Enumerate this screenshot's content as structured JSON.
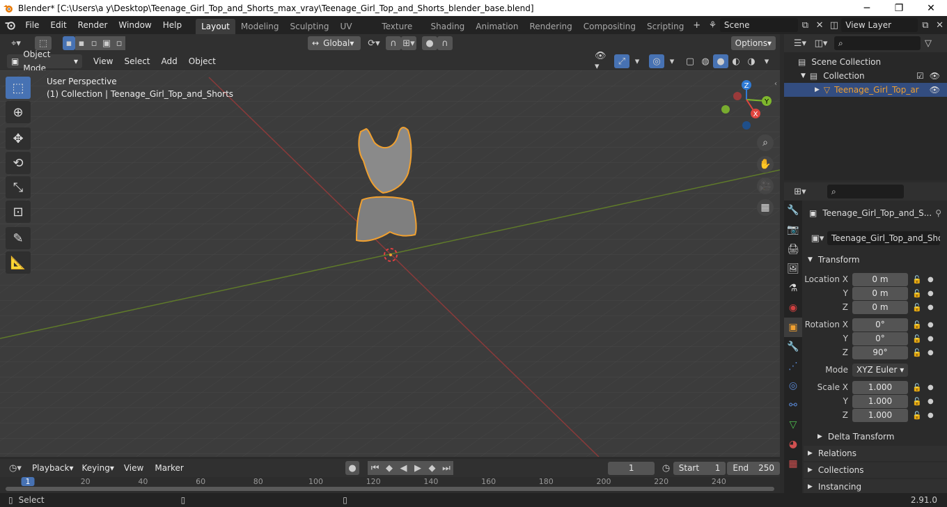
{
  "window": {
    "title": "Blender* [C:\\Users\\a y\\Desktop\\Teenage_Girl_Top_and_Shorts_max_vray\\Teenage_Girl_Top_and_Shorts_blender_base.blend]"
  },
  "menus": [
    "File",
    "Edit",
    "Render",
    "Window",
    "Help"
  ],
  "workspaces": [
    "Layout",
    "Modeling",
    "Sculpting",
    "UV Editing",
    "Texture Paint",
    "Shading",
    "Animation",
    "Rendering",
    "Compositing",
    "Scripting"
  ],
  "scene": {
    "name": "Scene",
    "view_layer": "View Layer"
  },
  "viewport": {
    "transform_orientation": "Global",
    "options_label": "Options",
    "mode": "Object Mode",
    "header_menus": [
      "View",
      "Select",
      "Add",
      "Object"
    ],
    "perspective_label": "User Perspective",
    "collection_label": "(1) Collection | Teenage_Girl_Top_and_Shorts",
    "axis_labels": {
      "x": "X",
      "y": "Y",
      "z": "Z"
    }
  },
  "outliner": {
    "scene_collection": "Scene Collection",
    "collection": "Collection",
    "object": "Teenage_Girl_Top_ar"
  },
  "properties": {
    "object_name": "Teenage_Girl_Top_and_S...",
    "mesh_name": "Teenage_Girl_Top_and_Shorts",
    "transform_title": "Transform",
    "location": {
      "label": "Location X",
      "x": "0 m",
      "y": "0 m",
      "z": "0 m"
    },
    "rotation": {
      "label": "Rotation X",
      "x": "0°",
      "y": "0°",
      "z": "90°"
    },
    "mode_label": "Mode",
    "mode_value": "XYZ Euler",
    "scale": {
      "label": "Scale X",
      "x": "1.000",
      "y": "1.000",
      "z": "1.000"
    },
    "axis_y": "Y",
    "axis_z": "Z",
    "delta": "Delta Transform",
    "sections": [
      "Relations",
      "Collections",
      "Instancing"
    ]
  },
  "timeline": {
    "menus": [
      "Playback",
      "Keying",
      "View",
      "Marker"
    ],
    "current_frame": "1",
    "start_label": "Start",
    "start": "1",
    "end_label": "End",
    "end": "250",
    "ticks": [
      "1",
      "20",
      "40",
      "60",
      "80",
      "100",
      "120",
      "140",
      "160",
      "180",
      "200",
      "220",
      "240"
    ]
  },
  "status": {
    "left": "Select",
    "version": "2.91.0"
  }
}
